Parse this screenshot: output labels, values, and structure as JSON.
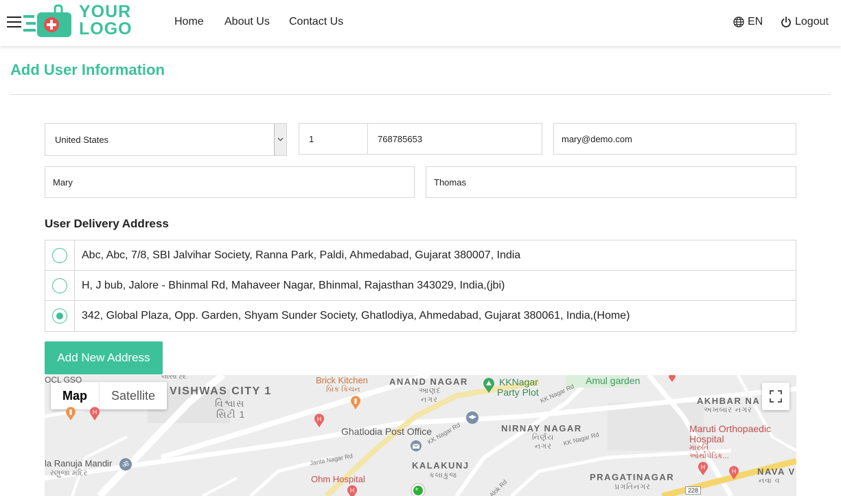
{
  "header": {
    "logo_line1": "YOUR",
    "logo_line2": "LOGO",
    "nav": [
      "Home",
      "About Us",
      "Contact Us"
    ],
    "language": "EN",
    "logout": "Logout"
  },
  "page": {
    "title": "Add User Information"
  },
  "form": {
    "country": "United States",
    "phone_code": "1",
    "phone_number": "768785653",
    "email": "mary@demo.com",
    "first_name": "Mary",
    "last_name": "Thomas"
  },
  "address_section": {
    "title": "User Delivery Address",
    "addresses": [
      {
        "text": "Abc, Abc, 7/8, SBI Jalvihar Society, Ranna Park, Paldi, Ahmedabad, Gujarat 380007, India",
        "selected": false
      },
      {
        "text": "H, J bub, Jalore - Bhinmal Rd, Mahaveer Nagar, Bhinmal, Rajasthan 343029, India,(jbi)",
        "selected": false
      },
      {
        "text": "342, Global Plaza, Opp. Garden, Shyam Sunder Society, Ghatlodiya, Ahmedabad, Gujarat 380061, India,(Home)",
        "selected": true
      }
    ],
    "add_button": "Add New Address"
  },
  "map": {
    "toggle": {
      "map": "Map",
      "satellite": "Satellite"
    },
    "labels": {
      "ocl": "OCL GSO",
      "vishwas_city": "VISHWAS CITY 1",
      "vishwas_gu1": "વિશ્વાસ",
      "vishwas_gu2": "સિટી 1",
      "top_gu": "લાસા હ્દ",
      "brick_kitchen": "Brick Kitchen",
      "brick_kitchen_gu": "બ્રિક કિચન",
      "anand_nagar": "ANAND NAGAR",
      "anand_nagar_gu": "આણંદ",
      "anand_nagar_gu2": "નગર",
      "kknagar": "KKNagar",
      "party_plot": "Party Plot",
      "amul_garden": "Amul garden",
      "akhbar_nagar": "AKHBAR NA",
      "akhbar_nagar_gu": "અખબાર નગર",
      "ghatlodia_post": "Ghatlodia Post Office",
      "nirnay_nagar": "NIRNAY NAGAR",
      "nirnay_gu1": "નિર્ણય",
      "nirnay_gu2": "નગર",
      "maruti": "Maruti Orthopaedic",
      "hospital": "Hospital",
      "maruti_gu1": "મારુતિ",
      "maruti_gu2": "ઓર્થોપેડિક...",
      "ranuja": "la Ranuja Mandir",
      "ranuja_gu": "રણુજા મંદિર",
      "kalakunj": "KALAKUNJ",
      "kalakunj_gu": "કલાકુંજ",
      "ohm": "Ohm Hospital",
      "pragatinagar": "PRAGATINAGAR",
      "pragatinagar_gu": "પ્રગતિનગર",
      "nava": "NAVA V",
      "nava_gu": "નવા વ",
      "kk_nagar_rd1": "KK Nagar Rd",
      "kk_nagar_rd2": "KK Nagar Rd",
      "kk_nagar_rd3": "KK Nagar Rd",
      "janta_nagar_rd": "Janta Nagar Rd",
      "alok_rd": "Alok Rd",
      "road_228": "228"
    }
  },
  "colors": {
    "accent": "#3cc19b",
    "logo_red": "#e84c4c"
  }
}
